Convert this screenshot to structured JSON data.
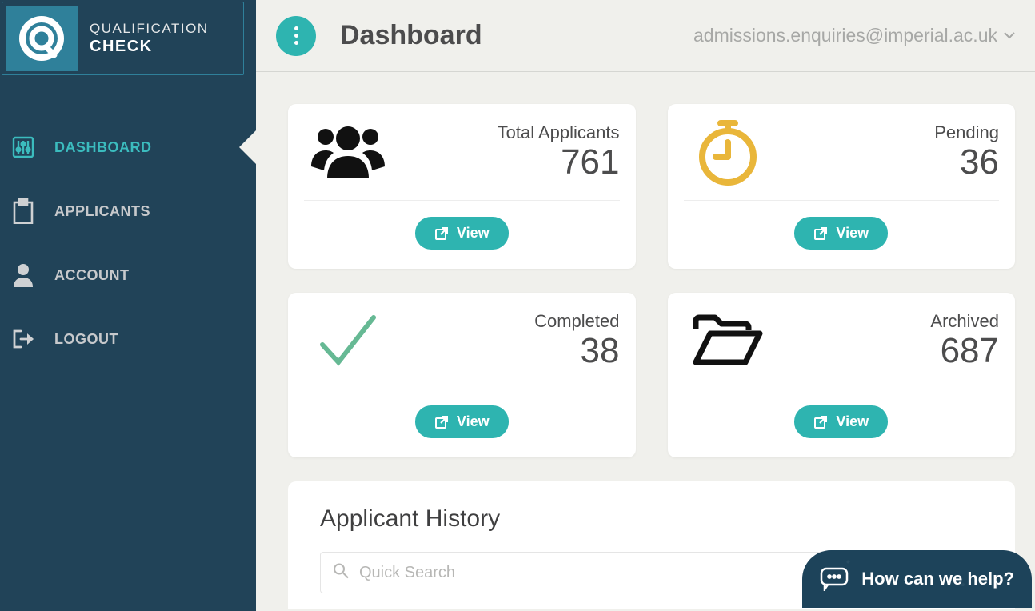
{
  "brand": {
    "line1": "QUALIFICATION",
    "line2": "CHECK"
  },
  "nav": {
    "dashboard": "DASHBOARD",
    "applicants": "APPLICANTS",
    "account": "ACCOUNT",
    "logout": "LOGOUT"
  },
  "header": {
    "title": "Dashboard",
    "user": "admissions.enquiries@imperial.ac.uk"
  },
  "cards": {
    "total": {
      "label": "Total Applicants",
      "value": "761",
      "button": "View"
    },
    "pending": {
      "label": "Pending",
      "value": "36",
      "button": "View"
    },
    "completed": {
      "label": "Completed",
      "value": "38",
      "button": "View"
    },
    "archived": {
      "label": "Archived",
      "value": "687",
      "button": "View"
    }
  },
  "history": {
    "title": "Applicant History",
    "search_placeholder": "Quick Search"
  },
  "help": {
    "text": "How can we help?"
  }
}
